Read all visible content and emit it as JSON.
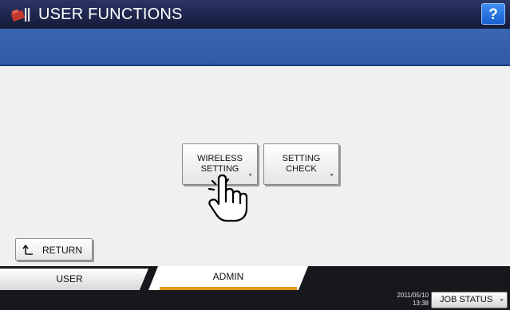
{
  "titlebar": {
    "title": "USER FUNCTIONS",
    "help_label": "?",
    "app_icon": "toolbox-icon"
  },
  "main": {
    "buttons": [
      {
        "line1": "WIRELESS",
        "line2": "SETTING",
        "arrow": "▸"
      },
      {
        "line1": "SETTING",
        "line2": "CHECK",
        "arrow": "▸"
      }
    ],
    "cursor_icon": "hand-pointer-icon",
    "return_label": "RETURN",
    "return_icon": "return-arrow-icon"
  },
  "tabs": [
    {
      "label": "USER",
      "active": false
    },
    {
      "label": "ADMIN",
      "active": true
    }
  ],
  "status": {
    "date": "2011/05/10",
    "time": "13:38",
    "job_status_label": "JOB STATUS",
    "arrow": "▸"
  },
  "colors": {
    "titlebar": "#141a38",
    "header_band": "#3a66b2",
    "active_tab_underline": "#e59a1c",
    "help_button": "#1a5fd0"
  }
}
